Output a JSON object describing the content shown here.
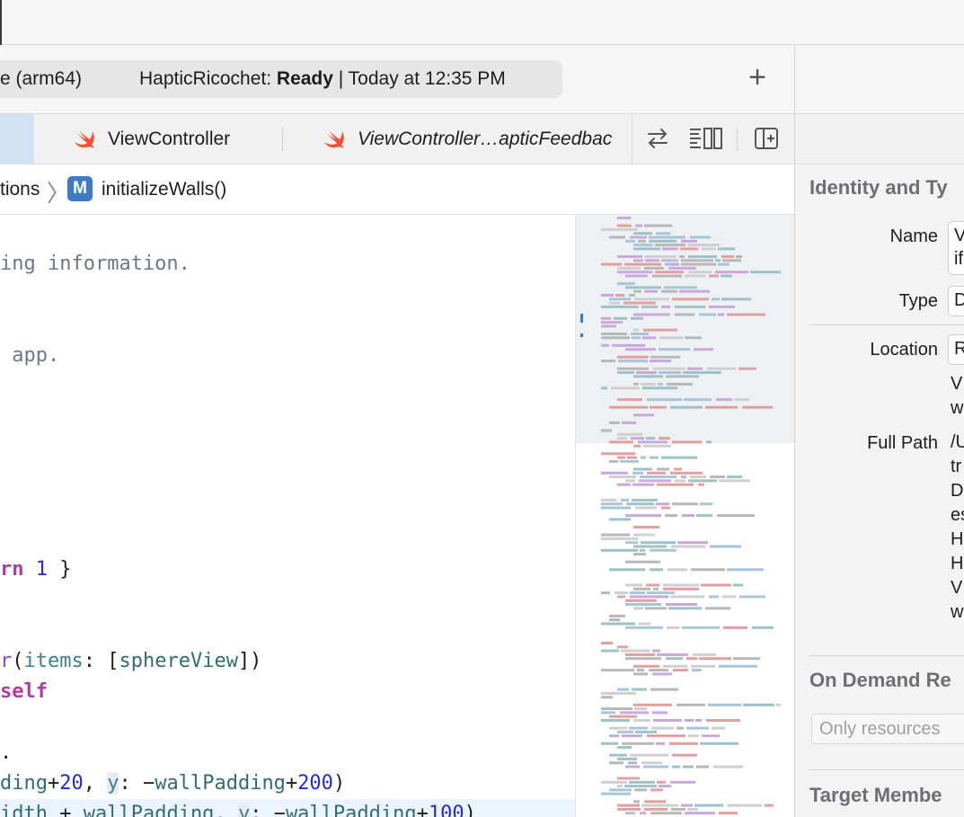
{
  "toolbar": {
    "destination": "e (arm64)",
    "status_scheme": "HapticRicochet: ",
    "status_state": "Ready",
    "status_time": " | Today at 12:35 PM",
    "add_label": "+"
  },
  "tabs": [
    {
      "label": "ViewController",
      "icon": "swift-icon"
    },
    {
      "label": "ViewController…apticFeedbac",
      "icon": "swift-icon"
    }
  ],
  "jumpbar": {
    "crumb_prev": "tions",
    "symbol_badge": "M",
    "crumb_current": "initializeWalls()"
  },
  "code_lines": {
    "l1": "ing information.",
    "l2": " app.",
    "l3_kw": "rn",
    "l3_num": "1",
    "l3_rest": " }",
    "l4_type": "r",
    "l4_param": "items",
    "l4_rest1": ": [",
    "l4_var": "sphereView",
    "l4_rest2": "])",
    "l5_kw": "self",
    "l6": ".",
    "l7_a": "ding",
    "l7_b": "+",
    "l7_n1": "20",
    "l7_c": ", ",
    "l7_y": "y",
    "l7_d": ": −",
    "l7_var": "wallPadding",
    "l7_e": "+",
    "l7_n2": "200",
    "l7_f": ")",
    "l8_a": "idth",
    "l8_b": " + ",
    "l8_var": "wallPadding",
    "l8_c": ", ",
    "l8_y": "y",
    "l8_d": ": −",
    "l8_var2": "wallPadding",
    "l8_e": "+",
    "l8_n": "100",
    "l8_f": ")"
  },
  "inspector": {
    "identity_title": "Identity and Ty",
    "name_label": "Name",
    "name_value": "V\nif",
    "type_label": "Type",
    "type_value": "D",
    "location_label": "Location",
    "location_value": "R",
    "location_text": "V\nw",
    "full_path_label": "Full Path",
    "full_path_value": "/U\ntr\nD\nes\nH\nH\nV\nw",
    "ondemand_title": "On Demand Re",
    "ondemand_placeholder": "Only resources",
    "target_title": "Target Membe"
  },
  "colors": {
    "accent": "#3f7bc4",
    "selected_tab": "#d4e3f3",
    "swift_orange": "#f05138",
    "keyword": "#ad3da4",
    "number": "#272ad8",
    "comment": "#6c7986"
  }
}
